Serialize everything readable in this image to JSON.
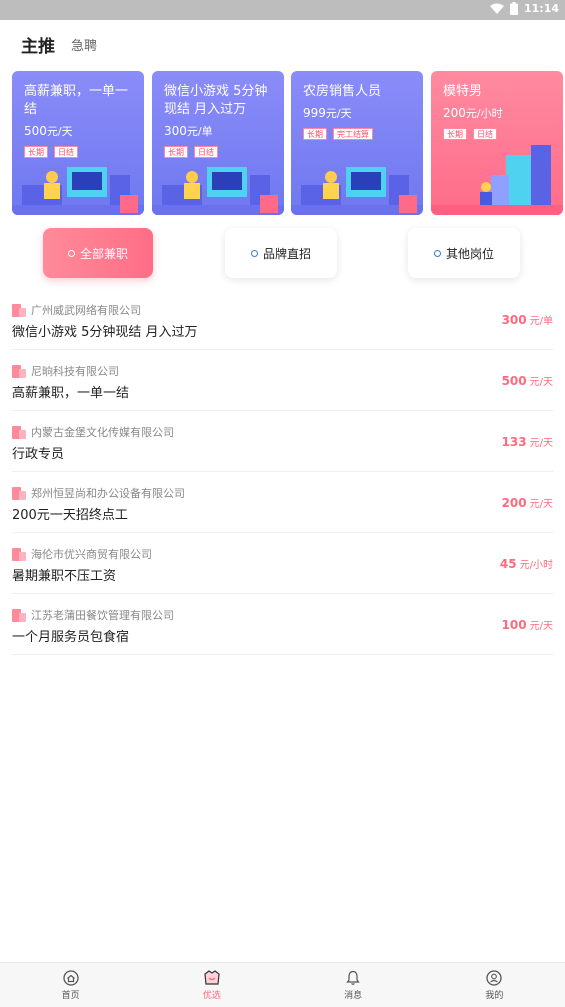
{
  "status_bar": {
    "time": "11:14"
  },
  "header": {
    "tabs": [
      {
        "label": "主推"
      },
      {
        "label": "急聘"
      }
    ]
  },
  "banners": [
    {
      "title": "高薪兼职，一单一结",
      "salary_value": "500",
      "salary_unit": "元/天",
      "tags": [
        "长期",
        "日结"
      ]
    },
    {
      "title": "微信小游戏 5分钟现结 月入过万",
      "salary_value": "300",
      "salary_unit": "元/单",
      "tags": [
        "长期",
        "日结"
      ]
    },
    {
      "title": "农房销售人员",
      "salary_value": "999",
      "salary_unit": "元/天",
      "tags": [
        "长期",
        "完工结算"
      ]
    },
    {
      "title": "模特男",
      "salary_value": "200",
      "salary_unit": "元/小时",
      "tags": [
        "长期",
        "日结"
      ]
    }
  ],
  "filters": [
    {
      "label": "全部兼职"
    },
    {
      "label": "品牌直招"
    },
    {
      "label": "其他岗位"
    }
  ],
  "jobs": [
    {
      "company": "广州威武网络有限公司",
      "title": "微信小游戏 5分钟现结 月入过万",
      "salary": "300",
      "unit": "元/单"
    },
    {
      "company": "尼晌科技有限公司",
      "title": "高薪兼职，一单一结",
      "salary": "500",
      "unit": "元/天"
    },
    {
      "company": "内蒙古金堡文化传媒有限公司",
      "title": "行政专员",
      "salary": "133",
      "unit": "元/天"
    },
    {
      "company": "郑州恒昱尚和办公设备有限公司",
      "title": "200元一天招终点工",
      "salary": "200",
      "unit": "元/天"
    },
    {
      "company": "海伦市优兴商贸有限公司",
      "title": "暑期兼职不压工资",
      "salary": "45",
      "unit": "元/小时"
    },
    {
      "company": "江苏老蒲田餐饮管理有限公司",
      "title": "一个月服务员包食宿",
      "salary": "100",
      "unit": "元/天"
    }
  ],
  "tabbar": [
    {
      "label": "首页",
      "icon": "home-icon"
    },
    {
      "label": "优选",
      "icon": "selected-icon"
    },
    {
      "label": "消息",
      "icon": "bell-icon"
    },
    {
      "label": "我的",
      "icon": "profile-icon"
    }
  ],
  "colors": {
    "accent": "#ff6a7f",
    "banner_blue": "#7a7ff3",
    "banner_pink": "#ff7590"
  }
}
